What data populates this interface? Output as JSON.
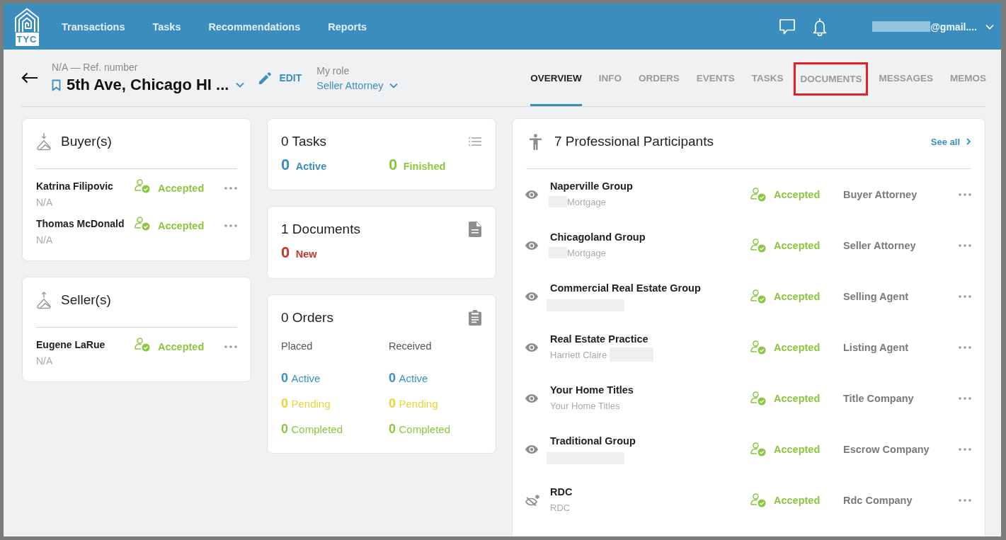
{
  "top_bar": {
    "logo": "TYC",
    "nav": [
      "Transactions",
      "Tasks",
      "Recommendations",
      "Reports"
    ],
    "user": {
      "email": "@gmail....",
      "redacted": true
    }
  },
  "header": {
    "ref": "N/A — Ref. number",
    "title": "5th Ave, Chicago HI ...",
    "edit": "EDIT",
    "role_label": "My role",
    "role_value": "Seller Attorney"
  },
  "tabs": [
    {
      "label": "OVERVIEW",
      "selected": true,
      "highlighted": false
    },
    {
      "label": "INFO",
      "selected": false,
      "highlighted": false
    },
    {
      "label": "ORDERS",
      "selected": false,
      "highlighted": false
    },
    {
      "label": "EVENTS",
      "selected": false,
      "highlighted": false
    },
    {
      "label": "TASKS",
      "selected": false,
      "highlighted": false
    },
    {
      "label": "DOCUMENTS",
      "selected": false,
      "highlighted": true
    },
    {
      "label": "MESSAGES",
      "selected": false,
      "highlighted": false
    },
    {
      "label": "MEMOS",
      "selected": false,
      "highlighted": false
    }
  ],
  "parties": [
    {
      "kind": "buyer",
      "title": "Buyer(s)",
      "items": [
        {
          "name": "Katrina Filipovic",
          "detail": "N/A",
          "status": "Accepted"
        },
        {
          "name": "Thomas McDonald",
          "detail": "N/A",
          "status": "Accepted"
        }
      ]
    },
    {
      "kind": "seller",
      "title": "Seller(s)",
      "items": [
        {
          "name": "Eugene LaRue",
          "detail": "N/A",
          "status": "Accepted"
        }
      ]
    }
  ],
  "tasks": {
    "title": "0 Tasks",
    "stats": [
      {
        "kind": "active",
        "count": "0",
        "label": "Active"
      },
      {
        "kind": "finished",
        "count": "0",
        "label": "Finished"
      }
    ]
  },
  "documents": {
    "title": "1 Documents",
    "stats": [
      {
        "kind": "new",
        "count": "0",
        "label": "New"
      }
    ]
  },
  "orders": {
    "title": "0 Orders",
    "columns": [
      {
        "heading": "Placed",
        "stats": [
          {
            "kind": "active",
            "count": "0",
            "label": "Active"
          },
          {
            "kind": "pending",
            "count": "0",
            "label": "Pending"
          },
          {
            "kind": "completed",
            "count": "0",
            "label": "Completed"
          }
        ]
      },
      {
        "heading": "Received",
        "stats": [
          {
            "kind": "active",
            "count": "0",
            "label": "Active"
          },
          {
            "kind": "pending",
            "count": "0",
            "label": "Pending"
          },
          {
            "kind": "completed",
            "count": "0",
            "label": "Completed"
          }
        ]
      }
    ]
  },
  "participants": {
    "title": "7 Professional Participants",
    "see_all": "See all",
    "items": [
      {
        "name": "Naperville Group",
        "subtitle": "Mortgage",
        "prefix_redacted": true,
        "visible": true,
        "status": "Accepted",
        "role": "Buyer Attorney"
      },
      {
        "name": "Chicagoland Group",
        "subtitle": "Mortgage",
        "prefix_redacted": true,
        "visible": true,
        "status": "Accepted",
        "role": "Seller Attorney"
      },
      {
        "name": "Commercial Real Estate Group",
        "detail_redacted": true,
        "visible": true,
        "status": "Accepted",
        "role": "Selling Agent"
      },
      {
        "name": "Real Estate Practice",
        "subtitle": "Harriett Claire",
        "suffix_redacted": true,
        "visible": true,
        "status": "Accepted",
        "role": "Listing Agent"
      },
      {
        "name": "Your Home Titles",
        "subtitle": "Your Home Titles",
        "visible": true,
        "status": "Accepted",
        "role": "Title Company"
      },
      {
        "name": "Traditional Group",
        "detail_redacted": true,
        "visible": true,
        "status": "Accepted",
        "role": "Escrow Company"
      },
      {
        "name": "RDC",
        "subtitle": "RDC",
        "visible": false,
        "status": "Accepted",
        "role": "Rdc Company"
      }
    ]
  }
}
